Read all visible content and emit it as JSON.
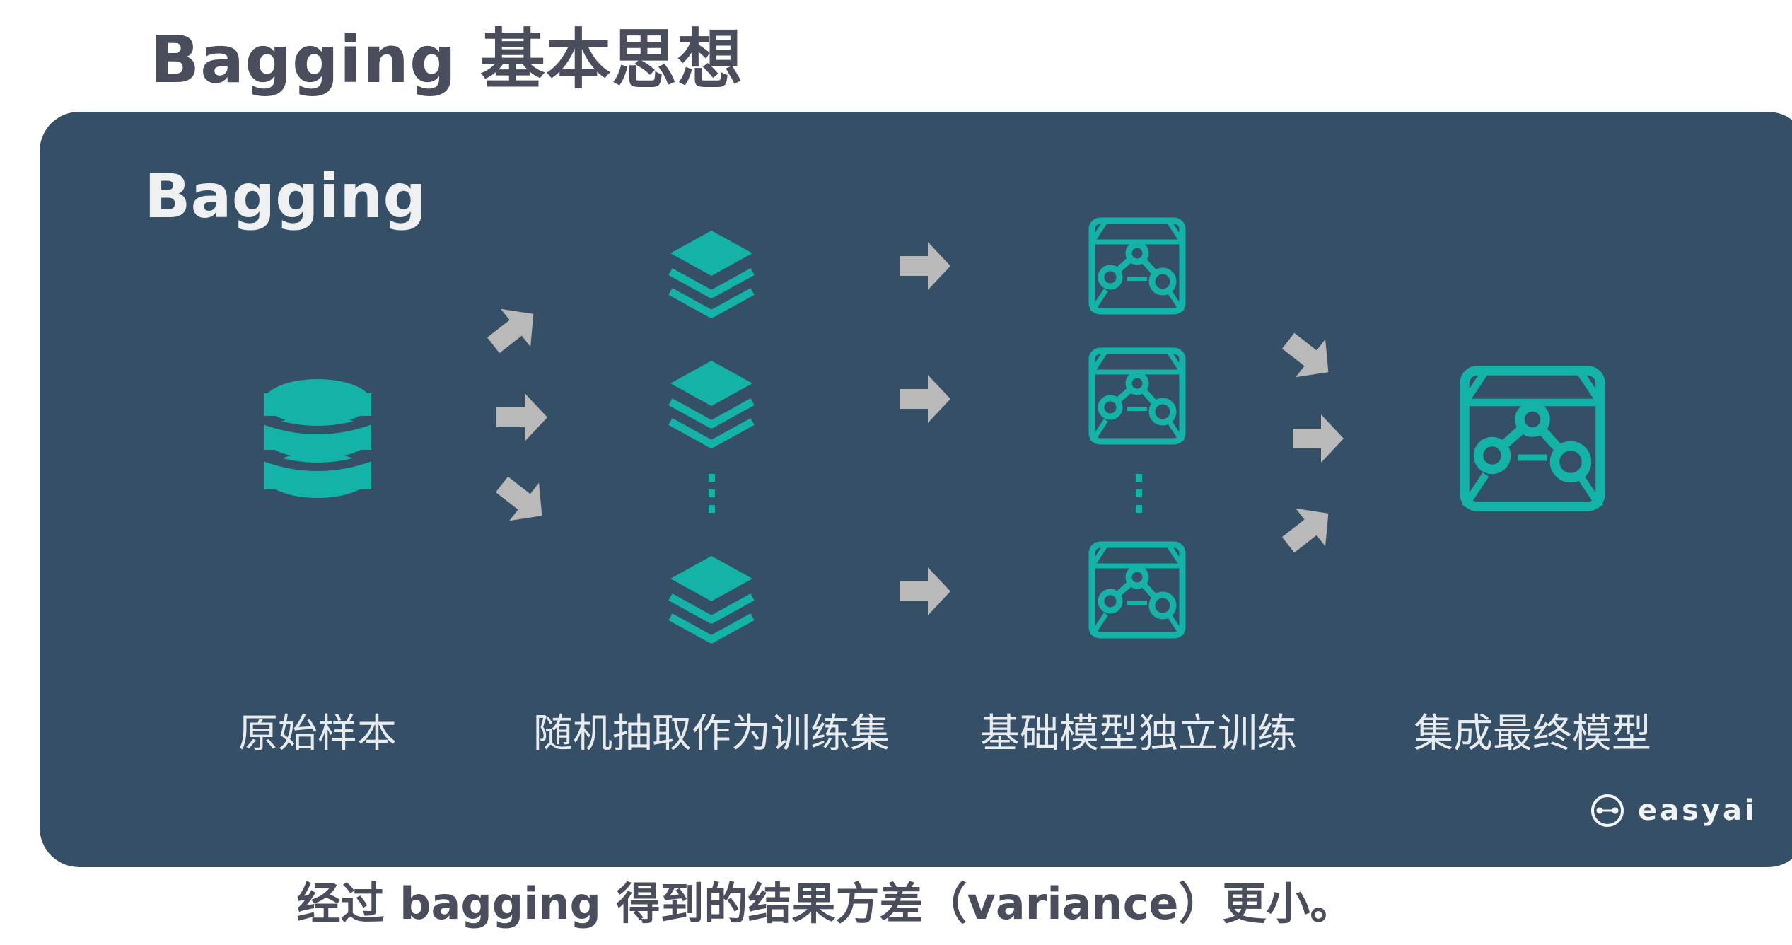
{
  "slide": {
    "title": "Bagging 基本思想",
    "caption": "经过 bagging 得到的结果方差（variance）更小。"
  },
  "panel": {
    "title": "Bagging",
    "stages": [
      {
        "label": "原始样本",
        "icon": "database-icon"
      },
      {
        "label": "随机抽取作为训练集",
        "icon": "layers-icon"
      },
      {
        "label": "基础模型独立训练",
        "icon": "model-box-icon"
      },
      {
        "label": "集成最终模型",
        "icon": "model-box-icon"
      }
    ],
    "ellipsis": "⋮",
    "brand": "easyai"
  },
  "colors": {
    "panel_bg": "#354f66",
    "teal": "#14b3a7",
    "arrow": "#b9b9b9",
    "title_text": "#4a4d5c",
    "label_text": "#e8ebee"
  }
}
